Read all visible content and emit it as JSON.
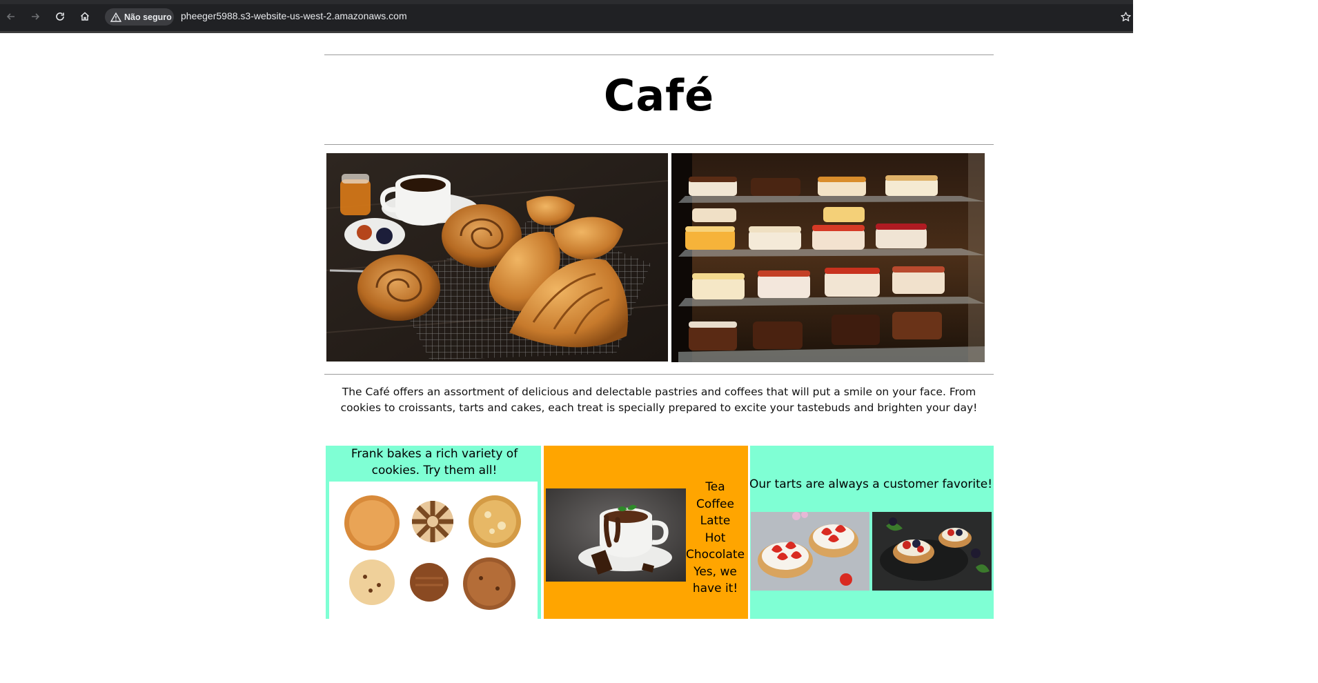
{
  "browser": {
    "security_label": "Não seguro",
    "url": "pheeger5988.s3-website-us-west-2.amazonaws.com",
    "icons": [
      "back-arrow-icon",
      "forward-arrow-icon",
      "reload-icon",
      "home-icon",
      "warning-icon",
      "bookmark-star-icon"
    ]
  },
  "page": {
    "title": "Café",
    "intro": "The Café offers an assortment of delicious and delectable pastries and coffees that will put a smile on your face. From cookies to croissants, tarts and cakes, each treat is specially prepared to excite your tastebuds and brighten your day!"
  },
  "panels": {
    "cookies": {
      "caption": "Frank bakes a rich variety of cookies. Try them all!",
      "bg_color": "#7fffd4"
    },
    "drinks": {
      "items": [
        "Tea",
        "Coffee",
        "Latte",
        "Hot",
        "Chocolate",
        "Yes, we",
        "have it!"
      ],
      "bg_color": "#ffa500"
    },
    "tarts": {
      "caption": "Our tarts are always a customer favorite!",
      "bg_color": "#7fffd4"
    }
  },
  "images": [
    "pastries-photo",
    "cake-display-photo",
    "cookies-photo",
    "hot-chocolate-photo",
    "strawberry-tarts-photo",
    "berry-tarts-photo"
  ]
}
